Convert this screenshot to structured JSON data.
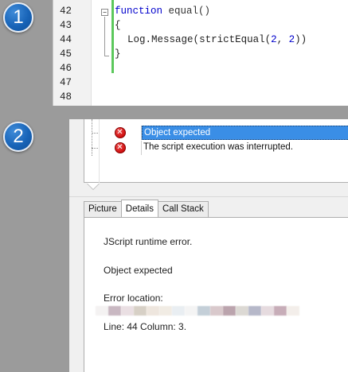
{
  "badges": {
    "step1": "1",
    "step2": "2"
  },
  "editor": {
    "line_numbers": [
      "42",
      "43",
      "44",
      "45",
      "46",
      "47",
      "48"
    ],
    "fold_symbol": "−",
    "code": {
      "line42": {
        "keyword": "function",
        "rest": " equal()"
      },
      "line43": "{",
      "line44": {
        "object": "Log",
        "dot": ".",
        "method": "Message",
        "open": "(",
        "call": "strictEqual",
        "args_open": "(",
        "arg1": "2",
        "sep": ", ",
        "arg2": "2",
        "close": "))"
      },
      "line45": "}"
    }
  },
  "log": {
    "rows": [
      {
        "icon": "error-icon",
        "text": "Object expected",
        "selected": true
      },
      {
        "icon": "error-icon",
        "text": "The script execution was interrupted.",
        "selected": false
      }
    ]
  },
  "tabs": [
    {
      "label": "Picture",
      "active": false
    },
    {
      "label": "Details",
      "active": true
    },
    {
      "label": "Call Stack",
      "active": false
    }
  ],
  "details": {
    "heading": "JScript runtime error.",
    "message": "Object expected",
    "location_label": "Error location:",
    "location_line": "Line: 44 Column: 3."
  },
  "colors": {
    "badge": "#1864b8",
    "selection": "#3a8ee6",
    "change_bar": "#5cc85c",
    "keyword": "#0000cc",
    "error": "#d01010"
  }
}
